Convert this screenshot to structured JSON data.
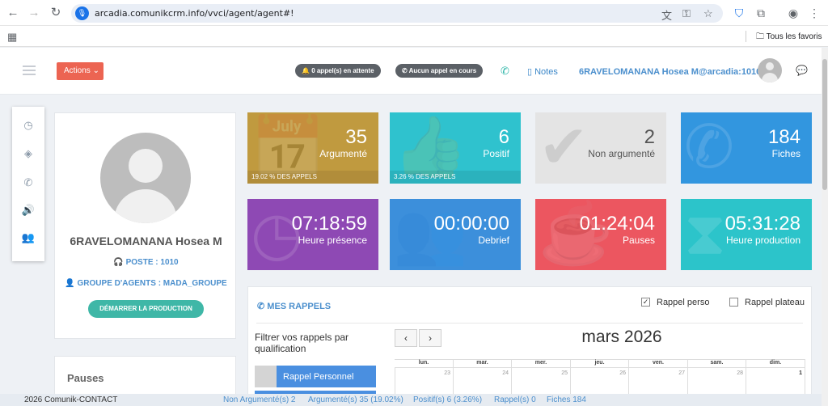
{
  "browser": {
    "url": "arcadia.comunikcrm.info/vvci/agent/agent#!",
    "bookmark_folder": "Tous les favoris"
  },
  "header": {
    "actions_label": "Actions",
    "waiting_calls": "0 appel(s) en attente",
    "current_call": "Aucun appel en cours",
    "notes_label": "Notes",
    "agent_id": "6RAVELOMANANA Hosea M@arcadia:1010"
  },
  "profile": {
    "name": "6RAVELOMANANA Hosea M",
    "poste": "POSTE : 1010",
    "group": "GROUPE D'AGENTS : MADA_GROUPE",
    "start_button": "DÉMARRER LA PRODUCTION"
  },
  "pauses_card": {
    "title": "Pauses"
  },
  "tiles": [
    {
      "value": "35",
      "label": "Argumenté",
      "footer": "19.02 % DES APPELS",
      "color": "#c09a3f",
      "icon": "calendar-check-icon"
    },
    {
      "value": "6",
      "label": "Positif",
      "footer": "3.26 % DES APPELS",
      "color": "#2fc2ce",
      "icon": "thumbs-up-icon"
    },
    {
      "value": "2",
      "label": "Non argumenté",
      "footer": "",
      "color": "#e4e4e4",
      "icon": "check-circle-icon"
    },
    {
      "value": "184",
      "label": "Fiches",
      "footer": "",
      "color": "#3296df",
      "icon": "phone-icon"
    },
    {
      "value": "07:18:59",
      "label": "Heure présence",
      "footer": "",
      "color": "#8e49b4",
      "icon": "clock-icon"
    },
    {
      "value": "00:00:00",
      "label": "Debrief",
      "footer": "",
      "color": "#3c8fdb",
      "icon": "users-icon"
    },
    {
      "value": "01:24:04",
      "label": "Pauses",
      "footer": "",
      "color": "#ec5660",
      "icon": "coffee-icon"
    },
    {
      "value": "05:31:28",
      "label": "Heure production",
      "footer": "",
      "color": "#2cc4ca",
      "icon": "hourglass-icon"
    }
  ],
  "rappels": {
    "title": "MES RAPPELS",
    "rappel_perso": "Rappel perso",
    "rappel_perso_checked": true,
    "rappel_plateau": "Rappel plateau",
    "rappel_plateau_checked": false,
    "filter_label": "Filtrer vos rappels par qualification",
    "qualification": "Rappel Personnel",
    "calendar_title": "mars 2026",
    "weekdays": [
      "lun.",
      "mar.",
      "mer.",
      "jeu.",
      "ven.",
      "sam.",
      "dim."
    ],
    "first_row_days": [
      "23",
      "24",
      "25",
      "26",
      "27",
      "28",
      "1"
    ]
  },
  "statusbar": {
    "copyright": "2026 Comunik-CONTACT",
    "non_argumente": "Non Argumenté(s) 2",
    "argumente": "Argumenté(s) 35 (19.02%)",
    "positif": "Positif(s) 6 (3.26%)",
    "rappel": "Rappel(s) 0",
    "fiches": "Fiches 184"
  }
}
